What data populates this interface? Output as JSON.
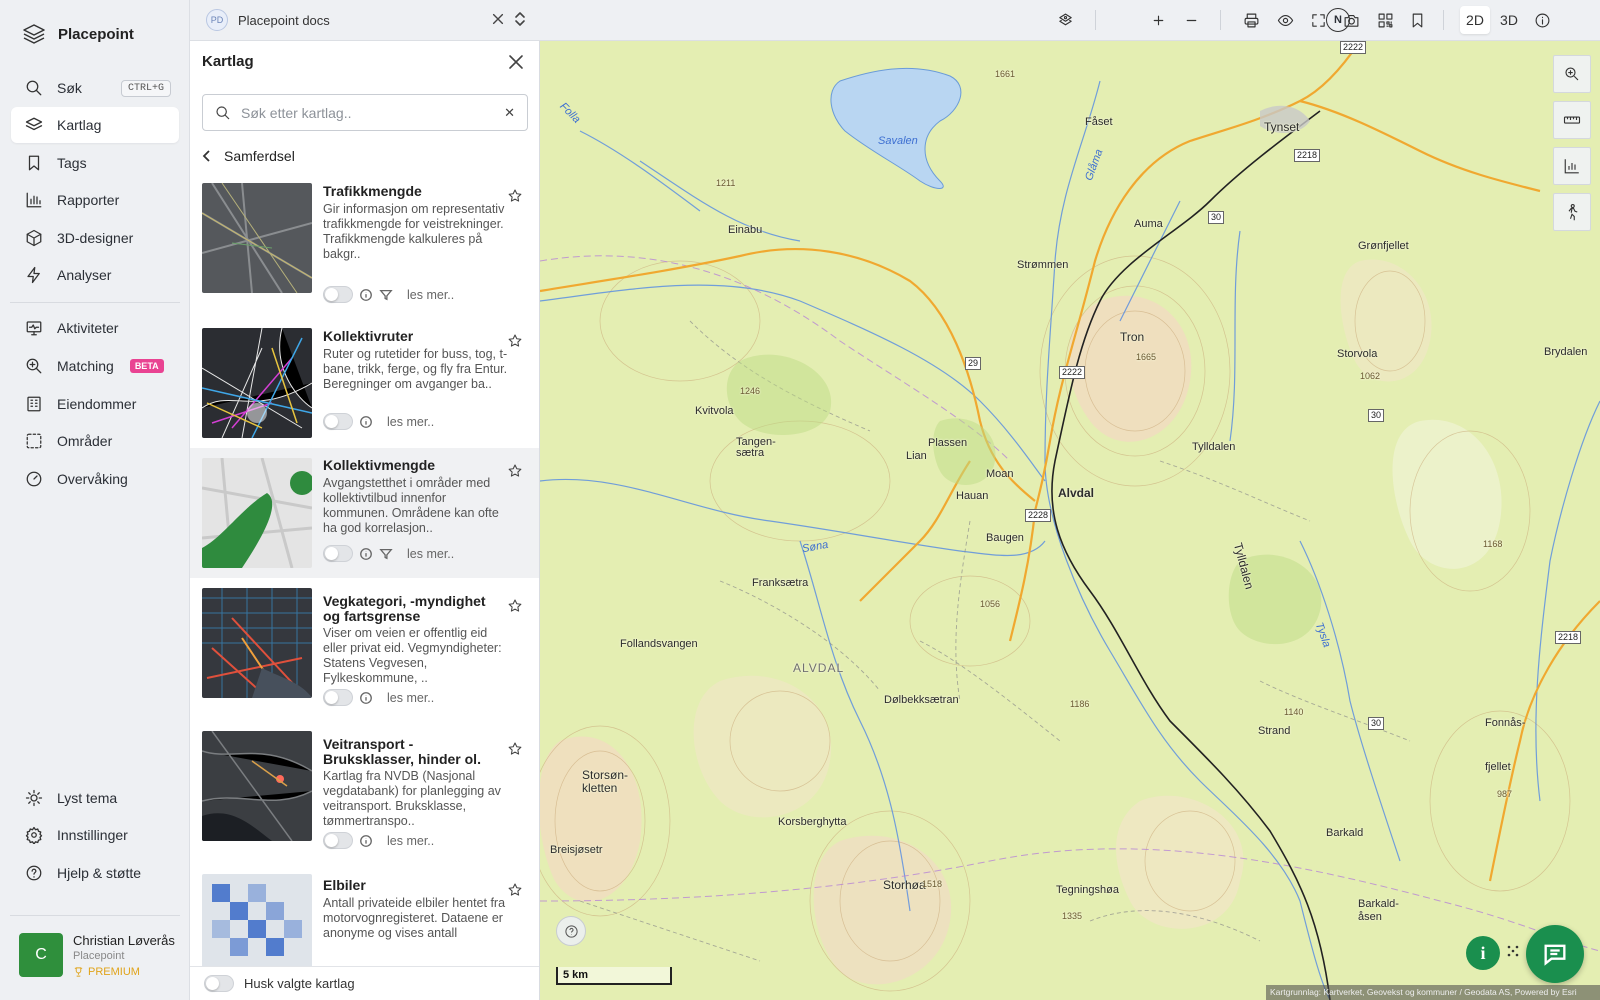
{
  "app": {
    "name": "Placepoint"
  },
  "nav": {
    "search_label": "Søk",
    "search_shortcut": "CTRL+G",
    "items": [
      {
        "label": "Kartlag"
      },
      {
        "label": "Tags"
      },
      {
        "label": "Rapporter"
      },
      {
        "label": "3D-designer"
      },
      {
        "label": "Analyser"
      },
      {
        "label": "Aktiviteter"
      },
      {
        "label": "Matching",
        "badge": "BETA"
      },
      {
        "label": "Eiendommer"
      },
      {
        "label": "Områder"
      },
      {
        "label": "Overvåking"
      }
    ],
    "bottom": [
      {
        "label": "Lyst tema"
      },
      {
        "label": "Innstillinger"
      },
      {
        "label": "Hjelp & støtte"
      }
    ],
    "user": {
      "initial": "C",
      "name": "Christian Løverås",
      "org": "Placepoint",
      "plan": "PREMIUM"
    }
  },
  "topbar": {
    "doc_initials": "PD",
    "doc_name": "Placepoint docs",
    "compass": "N",
    "mode_2d": "2D",
    "mode_3d": "3D"
  },
  "panel": {
    "title": "Kartlag",
    "search_placeholder": "Søk etter kartlag..",
    "breadcrumb": "Samferdsel",
    "read_more": "les mer..",
    "remember_label": "Husk valgte kartlag",
    "layers": [
      {
        "name": "Trafikkmengde",
        "desc": "Gir informasjon om representativ trafikkmengde for veistrekninger. Trafikkmengde kalkuleres på bakgr..",
        "filter": true
      },
      {
        "name": "Kollektivruter",
        "desc": "Ruter og rutetider for buss, tog, t-bane, trikk, ferge, og fly fra Entur. Beregninger om avganger ba..",
        "filter": false
      },
      {
        "name": "Kollektivmengde",
        "desc": "Avgangstetthet i områder med kollektivtilbud innenfor kommunen. Områdene kan ofte ha god korrelasjon..",
        "filter": true
      },
      {
        "name": "Vegkategori, -myndighet og fartsgrense",
        "desc": "Viser om veien er offentlig eid eller privat eid. Vegmyndigheter: Statens Vegvesen, Fylkeskommune, ..",
        "filter": false
      },
      {
        "name": "Veitransport - Bruksklasser, hinder ol.",
        "desc": "Kartlag fra NVDB (Nasjonal vegdatabank) for planlegging av veitransport. Bruksklasse, tømmertranspo..",
        "filter": false
      },
      {
        "name": "Elbiler",
        "desc": "Antall privateide elbiler hentet fra motorvognregisteret. Dataene er anonyme og vises antall",
        "filter": false
      }
    ]
  },
  "map": {
    "scale_label": "5 km",
    "attribution": "Kartgrunnlag: Kartverket, Geovekst og kommuner / Geodata AS, Powered by Esri",
    "places": [
      "Tynset",
      "Savalen",
      "Fåset",
      "Einabu",
      "Auma",
      "Grønfjellet",
      "Strømmen",
      "Tron",
      "Storvola",
      "Brydalen",
      "Kvitvola",
      "Tangen-sætra",
      "Lian",
      "Plassen",
      "Moan",
      "Hauan",
      "Alvdal",
      "Tylldalen",
      "Baugen",
      "Franksætra",
      "Follandsvangen",
      "ALVDAL",
      "Dølbekksætran",
      "Storsøn-kletten",
      "Korsberghytta",
      "Breisjøsetr",
      "Storhøa",
      "Tegningshøa",
      "Strand",
      "Barkald",
      "Barkald-åsen",
      "Fonnås-fjellet",
      "Glåma",
      "Folla",
      "Tylldalen",
      "Tysla",
      "Søna"
    ],
    "heights": [
      "1665",
      "1062",
      "1056",
      "1186",
      "1518",
      "1335",
      "1140",
      "987",
      "1211",
      "1246",
      "1661",
      "1168"
    ],
    "road_numbers": [
      "2222",
      "2218",
      "30",
      "29",
      "2228",
      "2222",
      "2218",
      "30",
      "30"
    ]
  }
}
